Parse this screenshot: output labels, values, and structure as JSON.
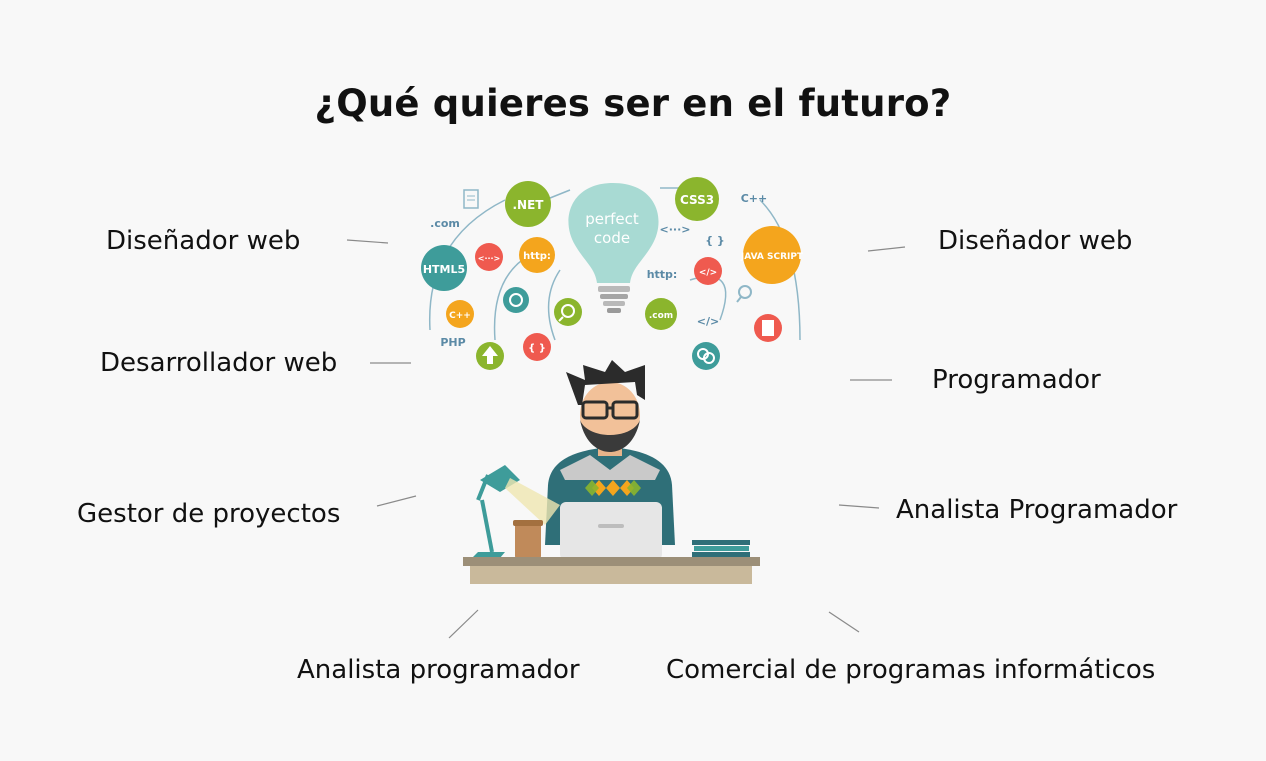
{
  "title": "¿Qué quieres ser en el futuro?",
  "labels": {
    "left_top": "Diseñador web",
    "right_top": "Diseñador web",
    "left_mid": "Desarrollador web",
    "right_mid": "Programador",
    "left_low": "Gestor de proyectos",
    "right_low": "Analista Programador",
    "bottom_left": "Analista programador",
    "bottom_right": "Comercial de programas informáticos"
  },
  "bulb": {
    "line1": "perfect",
    "line2": "code"
  },
  "bubbles": {
    "net": ".NET",
    "css3": "CSS3",
    "html5": "HTML5",
    "javascript": "JAVA SCRIPT",
    "http": "http:",
    "http2": "http:",
    "cpp": "C++",
    "cpp2": "C++",
    "php": "PHP",
    "com": ".com",
    "com2": ".com",
    "arrows": "<···>",
    "arrows2": "<···>",
    "tag": "</>",
    "tag2": "</>",
    "braces": "{ }",
    "braces2": "{ }"
  },
  "colors": {
    "green": "#8bb52d",
    "teal": "#3e9c9a",
    "red": "#ef5a4f",
    "orange": "#f4a51d",
    "bulb": "#a8dad3",
    "shirt": "#2f6f78",
    "desk": "#c9b99b"
  }
}
